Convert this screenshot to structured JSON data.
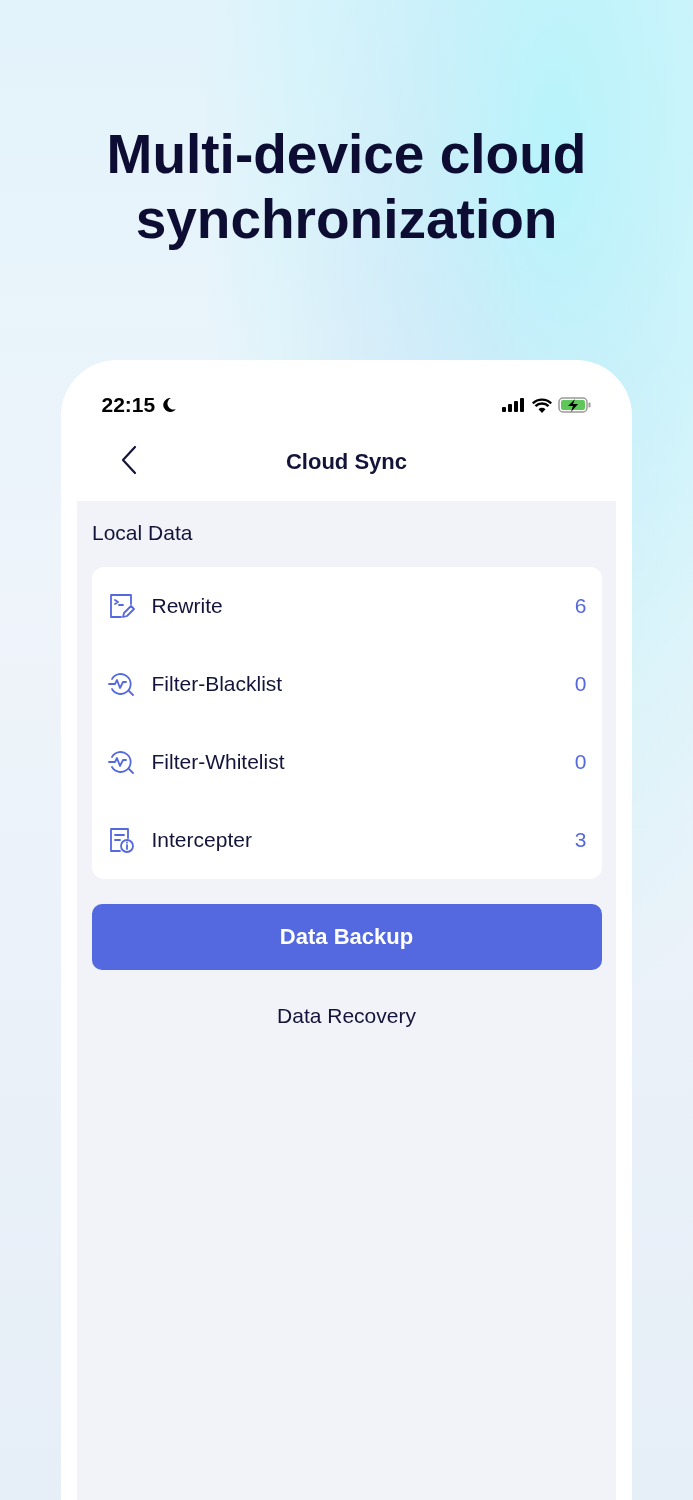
{
  "headline": "Multi-device cloud synchronization",
  "status_bar": {
    "time": "22:15"
  },
  "nav": {
    "title": "Cloud Sync"
  },
  "section": {
    "title": "Local Data"
  },
  "items": [
    {
      "kind": "script",
      "label": "Rewrite",
      "count": "6"
    },
    {
      "kind": "filter",
      "label": "Filter-Blacklist",
      "count": "0"
    },
    {
      "kind": "filter",
      "label": "Filter-Whitelist",
      "count": "0"
    },
    {
      "kind": "intercept",
      "label": "Intercepter",
      "count": "3"
    }
  ],
  "primary_button": "Data Backup",
  "secondary_button": "Data Recovery"
}
